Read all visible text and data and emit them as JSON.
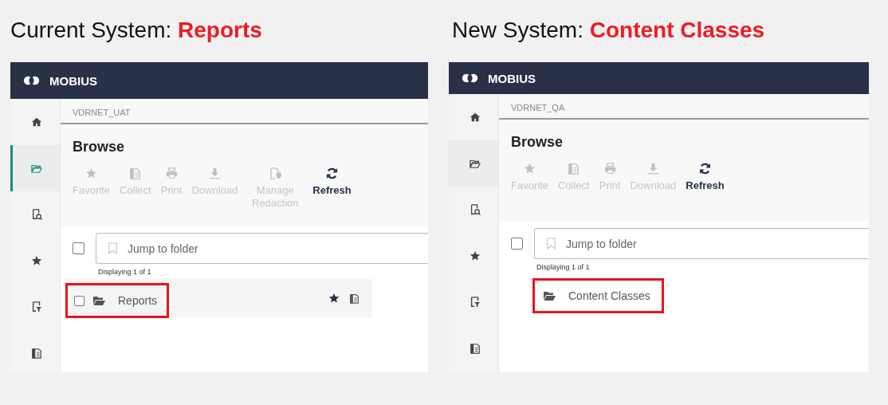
{
  "panels": [
    {
      "heading": "Current System:",
      "highlight": "Reports",
      "app": {
        "brand": "MOBIUS",
        "accent_bar": true,
        "nav": [
          {
            "kind": "home",
            "selected": false
          },
          {
            "kind": "folder",
            "selected": true
          },
          {
            "kind": "search",
            "selected": false
          },
          {
            "kind": "star",
            "selected": false
          },
          {
            "kind": "filter",
            "selected": false
          },
          {
            "kind": "doc",
            "selected": false
          }
        ],
        "repository": "VDRNET_UAT",
        "title": "Browse",
        "actions": [
          {
            "kind": "star",
            "label": "Favorite",
            "disabled": true
          },
          {
            "kind": "collect",
            "label": "Collect",
            "disabled": true
          },
          {
            "kind": "print",
            "label": "Print",
            "disabled": true
          },
          {
            "kind": "download",
            "label": "Download",
            "disabled": true
          },
          {
            "kind": "redaction",
            "label": "Manage Redaction",
            "disabled": true
          },
          {
            "kind": "refresh",
            "label": "Refresh",
            "disabled": false
          }
        ],
        "search": {
          "placeholder": "Jump to folder",
          "checked": false
        },
        "count": "Displaying 1 of 1",
        "items": [
          {
            "name": "Reports",
            "kind": "full",
            "checked": false,
            "highlighted": true
          }
        ]
      }
    },
    {
      "heading": "New System:",
      "highlight": "Content Classes",
      "app": {
        "brand": "MOBIUS",
        "accent_bar": false,
        "nav": [
          {
            "kind": "home",
            "selected": false
          },
          {
            "kind": "folder",
            "selected": true
          },
          {
            "kind": "search",
            "selected": false
          },
          {
            "kind": "star",
            "selected": false
          },
          {
            "kind": "filter",
            "selected": false
          },
          {
            "kind": "doc",
            "selected": false
          }
        ],
        "repository": "VDRNET_QA",
        "title": "Browse",
        "actions": [
          {
            "kind": "star",
            "label": "Favorite",
            "disabled": true
          },
          {
            "kind": "collect",
            "label": "Collect",
            "disabled": true
          },
          {
            "kind": "print",
            "label": "Print",
            "disabled": true
          },
          {
            "kind": "download",
            "label": "Download",
            "disabled": true
          },
          {
            "kind": "refresh",
            "label": "Refresh",
            "disabled": false
          }
        ],
        "search": {
          "placeholder": "Jump to folder",
          "checked": false
        },
        "count": "Displaying 1 of 1",
        "items": [
          {
            "name": "Content Classes",
            "kind": "plain",
            "highlighted": true
          }
        ]
      }
    }
  ]
}
